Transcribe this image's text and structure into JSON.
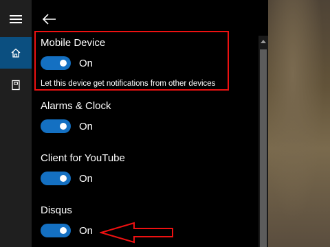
{
  "nav": {
    "menu_icon": "hamburger-menu-icon",
    "home_icon": "home-icon",
    "notebook_icon": "notebook-icon",
    "back_icon": "back-arrow-icon"
  },
  "settings": {
    "items": [
      {
        "title": "Mobile Device",
        "state": "On",
        "description": "Let this device get notifications from other devices"
      },
      {
        "title": "Alarms & Clock",
        "state": "On"
      },
      {
        "title": "Client for YouTube",
        "state": "On"
      },
      {
        "title": "Disqus",
        "state": "On"
      }
    ]
  },
  "colors": {
    "accent": "#1470c2",
    "annotation": "#ee1111",
    "rail_selected": "#0b4f80"
  }
}
